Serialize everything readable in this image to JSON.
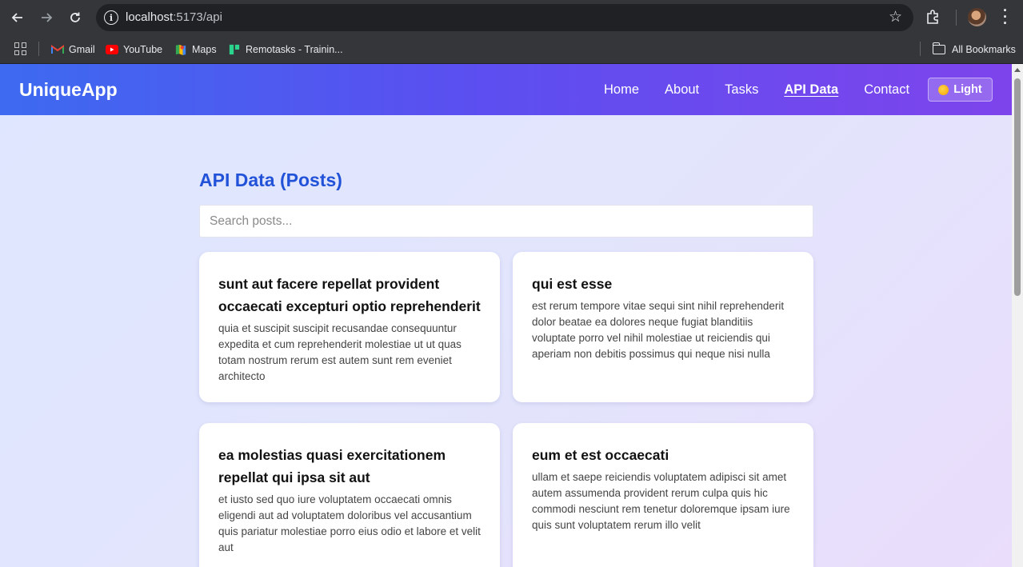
{
  "browser": {
    "url_host": "localhost",
    "url_path": ":5173/api",
    "bookmarks": [
      {
        "label": "Gmail",
        "icon": "gmail-icon"
      },
      {
        "label": "YouTube",
        "icon": "youtube-icon"
      },
      {
        "label": "Maps",
        "icon": "maps-icon"
      },
      {
        "label": "Remotasks - Trainin...",
        "icon": "remotasks-icon"
      }
    ],
    "all_bookmarks": "All Bookmarks"
  },
  "navbar": {
    "brand": "UniqueApp",
    "links": [
      "Home",
      "About",
      "Tasks",
      "API Data",
      "Contact"
    ],
    "active_link": "API Data",
    "theme_toggle_label": "Light",
    "colors": {
      "gradient_start": "#3d6af0",
      "gradient_end": "#7e44ec"
    }
  },
  "main": {
    "title": "API Data (Posts)",
    "search_placeholder": "Search posts...",
    "posts": [
      {
        "title": "sunt aut facere repellat provident occaecati excepturi optio reprehenderit",
        "body": "quia et suscipit suscipit recusandae consequuntur expedita et cum reprehenderit molestiae ut ut quas totam nostrum rerum est autem sunt rem eveniet architecto"
      },
      {
        "title": "qui est esse",
        "body": "est rerum tempore vitae sequi sint nihil reprehenderit dolor beatae ea dolores neque fugiat blanditiis voluptate porro vel nihil molestiae ut reiciendis qui aperiam non debitis possimus qui neque nisi nulla"
      },
      {
        "title": "ea molestias quasi exercitationem repellat qui ipsa sit aut",
        "body": "et iusto sed quo iure voluptatem occaecati omnis eligendi aut ad voluptatem doloribus vel accusantium quis pariatur molestiae porro eius odio et labore et velit aut"
      },
      {
        "title": "eum et est occaecati",
        "body": "ullam et saepe reiciendis voluptatem adipisci sit amet autem assumenda provident rerum culpa quis hic commodi nesciunt rem tenetur doloremque ipsam iure quis sunt voluptatem rerum illo velit"
      }
    ]
  }
}
